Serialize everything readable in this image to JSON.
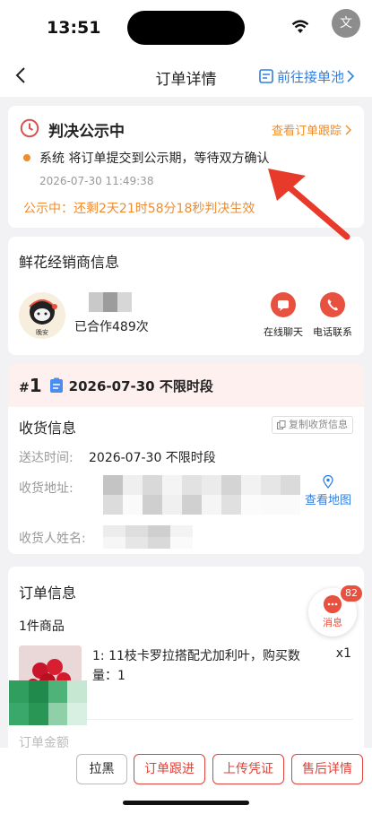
{
  "status_bar": {
    "time": "13:51",
    "translate_glyph": "文"
  },
  "navbar": {
    "title": "订单详情",
    "goto_pool": "前往接单池"
  },
  "verdict": {
    "title": "判决公示中",
    "view_track": "查看订单跟踪",
    "message": "系统 将订单提交到公示期，等待双方确认",
    "time": "2026-07-30 11:49:38",
    "countdown": "公示中：还剩2天21时58分18秒判决生效"
  },
  "dealer": {
    "section_title": "鲜花经销商信息",
    "avatar_caption": "晚安",
    "coop_count": "已合作489次",
    "chat_label": "在线聊天",
    "phone_label": "电话联系"
  },
  "delivery": {
    "seq_hash": "#",
    "seq_num": "1",
    "date": "2026-07-30 不限时段",
    "section_title": "收货信息",
    "copy_label": "复制收货信息",
    "time_label": "送达时间:",
    "time_value": "2026-07-30 不限时段",
    "address_label": "收货地址:",
    "map_label": "查看地图",
    "name_label": "收货人姓名:"
  },
  "order": {
    "section_title": "订单信息",
    "goods_count": "1件商品",
    "goods_title": "1:   11枝卡罗拉搭配尤加利叶，购买数量：1",
    "goods_qty": "x1",
    "cut_text": "订单金额"
  },
  "float_msg": {
    "label": "消息",
    "badge": "82"
  },
  "actions": {
    "blacklist": "拉黑",
    "follow": "订单跟进",
    "upload": "上传凭证",
    "after_sale": "售后详情"
  },
  "colors": {
    "accent_orange": "#f08c2b",
    "accent_red": "#e0433a",
    "link_blue": "#2d7fe6"
  }
}
